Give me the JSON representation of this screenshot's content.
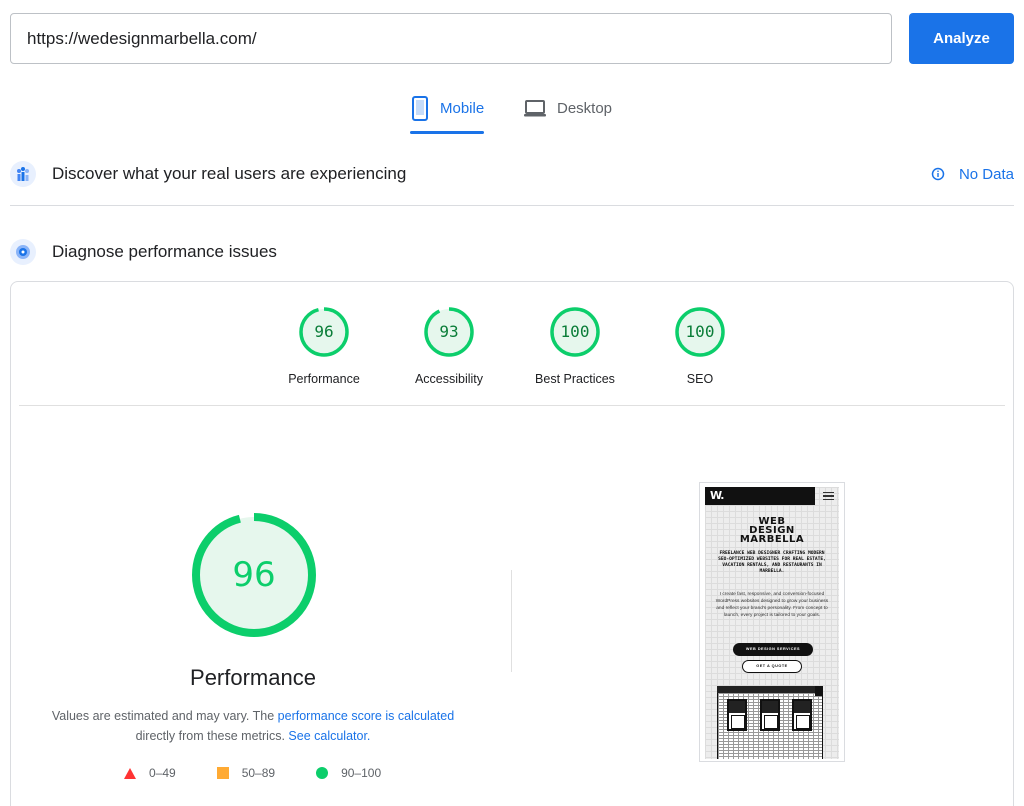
{
  "search": {
    "value": "https://wedesignmarbella.com/",
    "button_label": "Analyze"
  },
  "tabs": [
    {
      "label": "Mobile",
      "icon": "mobile-icon",
      "active": true
    },
    {
      "label": "Desktop",
      "icon": "laptop-icon",
      "active": false
    }
  ],
  "field_data": {
    "title": "Discover what your real users are experiencing",
    "status": "No Data",
    "icon": "users-chart-icon"
  },
  "lab_data": {
    "title": "Diagnose performance issues",
    "icon": "gauge-icon"
  },
  "categories": [
    {
      "label": "Performance",
      "score": "96"
    },
    {
      "label": "Accessibility",
      "score": "93"
    },
    {
      "label": "Best Practices",
      "score": "100"
    },
    {
      "label": "SEO",
      "score": "100"
    }
  ],
  "performance": {
    "score": "96",
    "title": "Performance",
    "desc_prefix": "Values are estimated and may vary. The",
    "desc_link1": "performance score is calculated",
    "desc_middle": "directly from these metrics.",
    "desc_link2": "See calculator.",
    "legend": [
      "0–49",
      "50–89",
      "90–100"
    ]
  },
  "screenshot": {
    "logo": "W.",
    "title_lines": [
      "WEB",
      "DESIGN",
      "MARBELLA"
    ],
    "subtitle": "FREELANCE WEB DESIGNER CRAFTING MODERN SEO-OPTIMIZED WEBSITES FOR REAL ESTATE, VACATION RENTALS, AND RESTAURANTS IN MARBELLA.",
    "body": "I create fast, responsive, and conversion-focused WordPress websites designed to grow your business and reflect your brand's personality. From concept to launch, every project is tailored to your goals.",
    "btn_primary": "WEB DESIGN SERVICES",
    "btn_secondary": "GET A QUOTE"
  },
  "colors": {
    "accent": "#1a73e8",
    "pass": "#0cce6b",
    "average": "#ffaa33",
    "fail": "#ff3333"
  }
}
